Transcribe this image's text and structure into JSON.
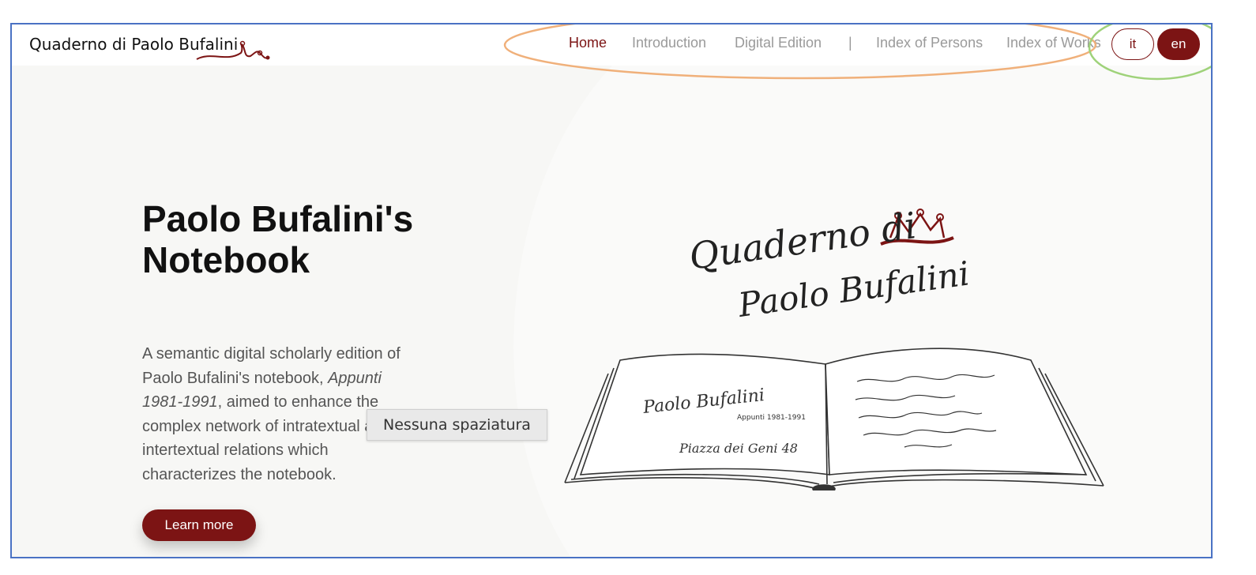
{
  "brand": {
    "name": "Quaderno di Paolo Bufalini"
  },
  "nav": {
    "items": [
      {
        "label": "Home",
        "active": true
      },
      {
        "label": "Introduction",
        "active": false
      },
      {
        "label": "Digital Edition",
        "active": false
      },
      {
        "label": "Index of Persons",
        "active": false
      },
      {
        "label": "Index of Works",
        "active": false
      }
    ],
    "separator": "|"
  },
  "lang": {
    "it": "it",
    "en": "en",
    "selected": "en"
  },
  "hero": {
    "title": "Paolo Bufalini's Notebook",
    "desc_before": "A semantic digital scholarly edition of Paolo Bufalini's notebook, ",
    "desc_italic": "Appunti 1981-1991",
    "desc_after": ", aimed to enhance the complex network of intratextual and intertextual relations which characterizes the notebook.",
    "button": "Learn more"
  },
  "tooltip": {
    "text": "Nessuna spaziatura"
  },
  "illustration": {
    "logo_text_line1": "Quaderno di",
    "logo_text_line2": "Paolo Bufalini",
    "page_left_line1": "Paolo Bufalini",
    "page_left_line2": "Appunti 1981-1991",
    "page_left_line3": "Piazza dei Geni 48"
  },
  "colors": {
    "accent": "#7c1414",
    "frame": "#4a72c4",
    "annotation_orange": "#f0b07a",
    "annotation_green": "#9fd27a"
  }
}
